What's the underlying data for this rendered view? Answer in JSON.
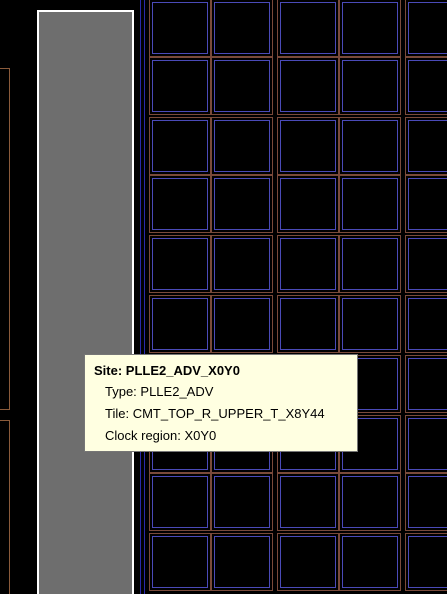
{
  "tooltip": {
    "title": "Site: PLLE2_ADV_X0Y0",
    "type_line": "Type: PLLE2_ADV",
    "tile_line": "Tile: CMT_TOP_R_UPPER_T_X8Y44",
    "clock_region_line": "Clock region: X0Y0"
  },
  "colors": {
    "background": "#000000",
    "selected_site_fill": "#6e6e6e",
    "selected_site_border": "#ffffff",
    "tile_outline": "#7a4a3a",
    "site_outline": "#4a4ab8",
    "tooltip_background": "#ffffe1"
  }
}
